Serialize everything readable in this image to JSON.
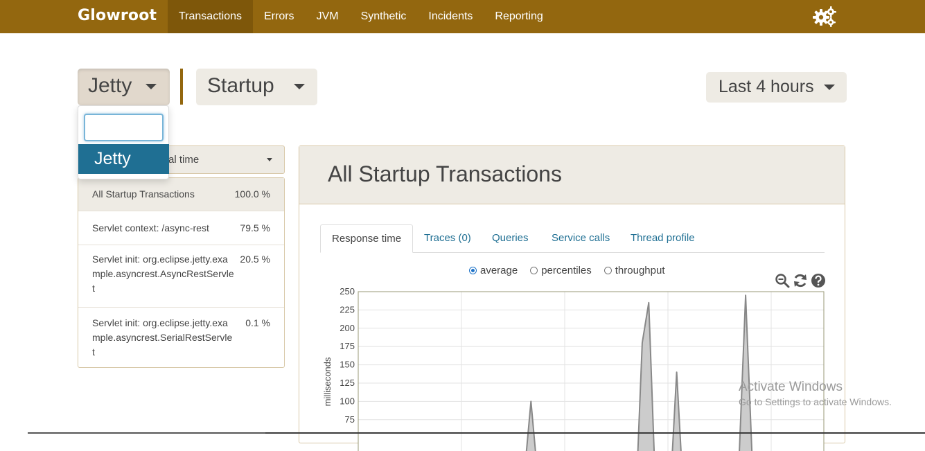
{
  "navbar": {
    "brand": "Glowroot",
    "items": [
      {
        "label": "Transactions",
        "active": true
      },
      {
        "label": "Errors"
      },
      {
        "label": "JVM"
      },
      {
        "label": "Synthetic"
      },
      {
        "label": "Incidents"
      },
      {
        "label": "Reporting"
      }
    ],
    "settings_icon": "gears-icon"
  },
  "selectors": {
    "agent": "Jetty",
    "transaction_type": "Startup",
    "time_range": "Last 4 hours"
  },
  "agent_dropdown": {
    "search_value": "",
    "options": [
      "Jetty"
    ]
  },
  "sort": {
    "visible_label": "al time"
  },
  "transactions": [
    {
      "name": "All Startup Transactions",
      "percent": "100.0 %",
      "selected": true
    },
    {
      "name": "Servlet context: /async-rest",
      "percent": "79.5 %"
    },
    {
      "name": "Servlet init: org.eclipse.jetty.example.asyncrest.AsyncRestServlet",
      "percent": "20.5 %"
    },
    {
      "name": "Servlet init: org.eclipse.jetty.example.asyncrest.SerialRestServlet",
      "percent": "0.1 %"
    }
  ],
  "panel": {
    "title": "All Startup Transactions",
    "tabs": [
      "Response time",
      "Traces (0)",
      "Queries",
      "Service calls",
      "Thread profile"
    ],
    "active_tab": "Response time",
    "modes": [
      {
        "label": "average",
        "checked": true
      },
      {
        "label": "percentiles",
        "checked": false
      },
      {
        "label": "throughput",
        "checked": false
      }
    ],
    "tool_icons": [
      "zoom-out-icon",
      "refresh-icon",
      "help-icon"
    ]
  },
  "chart_data": {
    "type": "area",
    "ylabel": "milliseconds",
    "yticks": [
      250,
      225,
      200,
      175,
      150,
      125,
      100,
      75
    ],
    "ylim": [
      65,
      250
    ],
    "grid": true,
    "xlim": [
      0,
      100
    ],
    "spikes": [
      {
        "x": [
          36.0,
          37.1,
          38.2
        ],
        "y": [
          0,
          100,
          0
        ]
      },
      {
        "x": [
          60.0,
          61.0,
          62.4,
          63.6
        ],
        "y": [
          0,
          180,
          235,
          0
        ]
      },
      {
        "x": [
          67.4,
          68.4,
          69.4
        ],
        "y": [
          0,
          140,
          0
        ]
      },
      {
        "x": [
          81.8,
          83.2,
          84.6
        ],
        "y": [
          0,
          245,
          0
        ]
      }
    ]
  },
  "watermark": {
    "line1": "Activate Windows",
    "line2": "Go to Settings to activate Windows."
  },
  "colors": {
    "navbar": "#93670f",
    "navbar_active": "#7e570a",
    "selected_option": "#1f6f93",
    "panel_head": "#eeebe4"
  }
}
